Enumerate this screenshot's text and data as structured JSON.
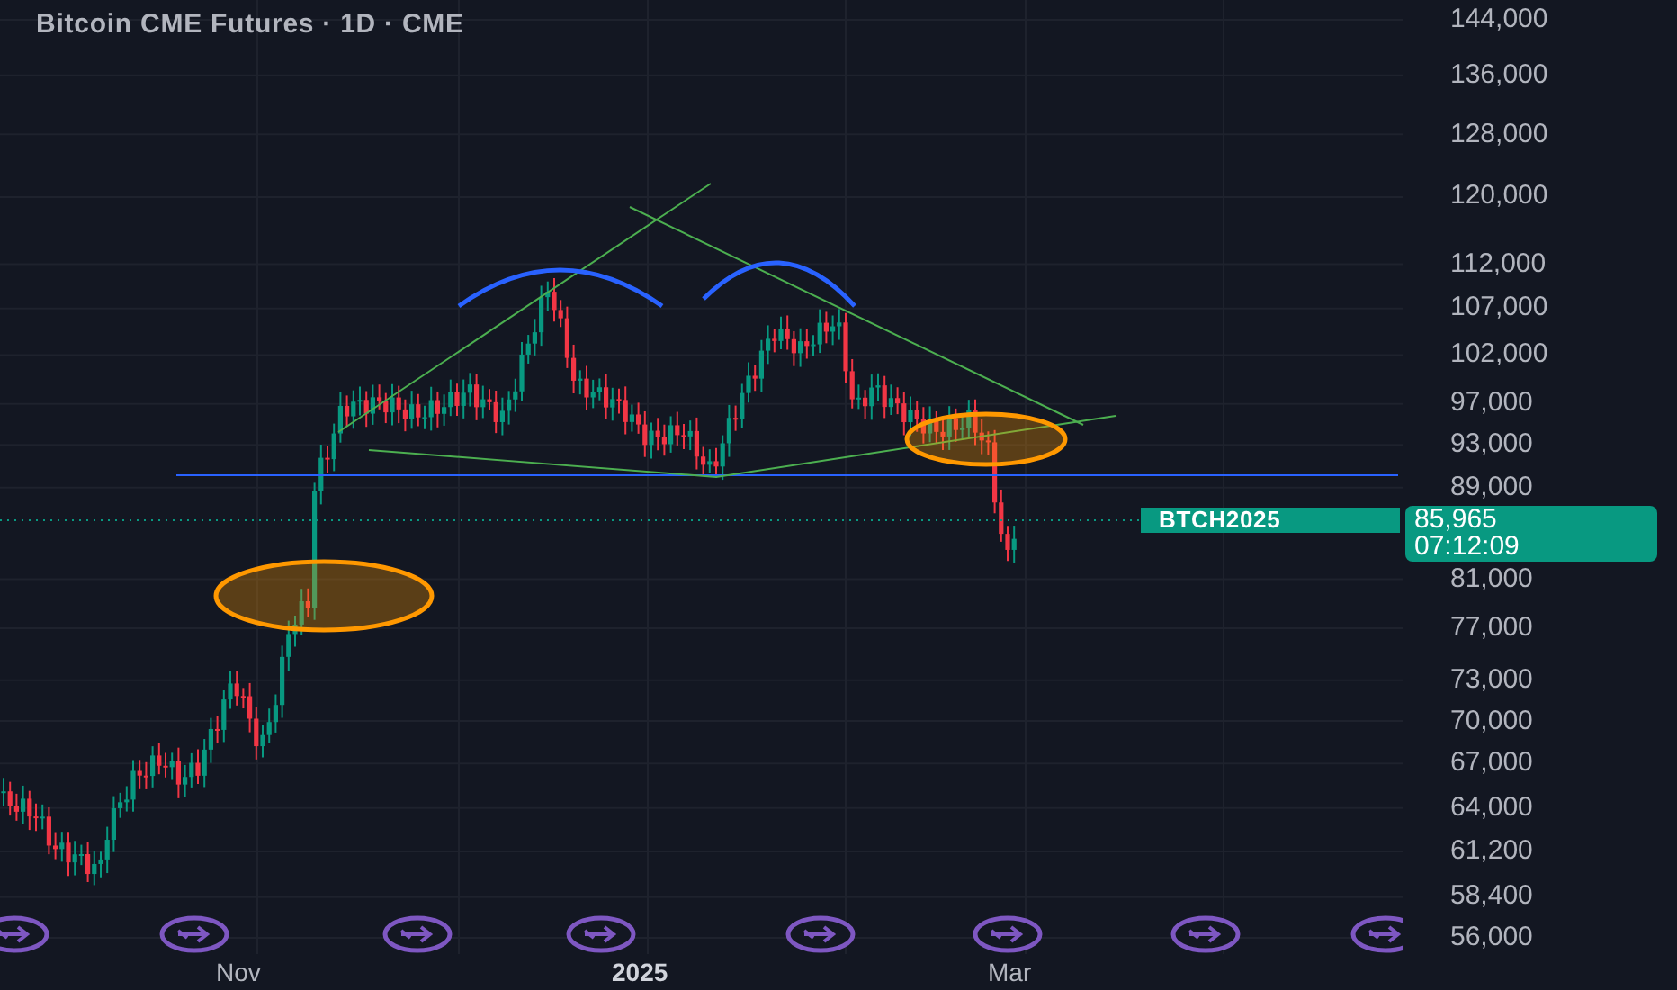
{
  "title": "Bitcoin CME Futures · 1D · CME",
  "price_axis": {
    "labels": [
      "144,000",
      "136,000",
      "128,000",
      "120,000",
      "112,000",
      "107,000",
      "102,000",
      "97,000",
      "93,000",
      "89,000",
      "81,000",
      "77,000",
      "73,000",
      "70,000",
      "67,000",
      "64,000",
      "61,200",
      "58,400",
      "56,000"
    ]
  },
  "time_axis": {
    "labels": [
      {
        "label": "Nov",
        "kind": "month"
      },
      {
        "label": "2025",
        "kind": "year"
      },
      {
        "label": "Mar",
        "kind": "month"
      }
    ]
  },
  "symbol_tag": "BTCH2025",
  "last_price": {
    "price": "85,965",
    "countdown": "07:12:09"
  }
}
